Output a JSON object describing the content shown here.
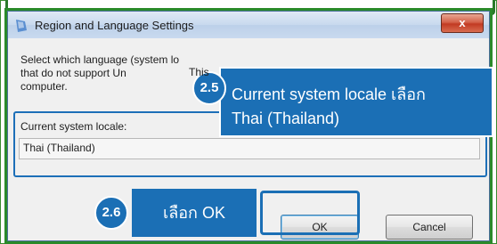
{
  "window": {
    "title": "Region and Language Settings",
    "close_label": "x"
  },
  "description": {
    "lines": [
      "Select which language (system lo",
      "that do not support Un",
      "computer."
    ],
    "line2_suffix": "This"
  },
  "field": {
    "label": "Current system locale:",
    "value": "Thai (Thailand)"
  },
  "callout": {
    "step": "2.5",
    "line1": "Current system locale เลือก",
    "line2": "Thai (Thailand)"
  },
  "step_ok": {
    "step": "2.6",
    "label": "เลือก OK"
  },
  "buttons": {
    "ok": "OK",
    "cancel": "Cancel"
  },
  "colors": {
    "callout_bg": "#1b6fb5",
    "frame_green": "#2a8a2a"
  }
}
